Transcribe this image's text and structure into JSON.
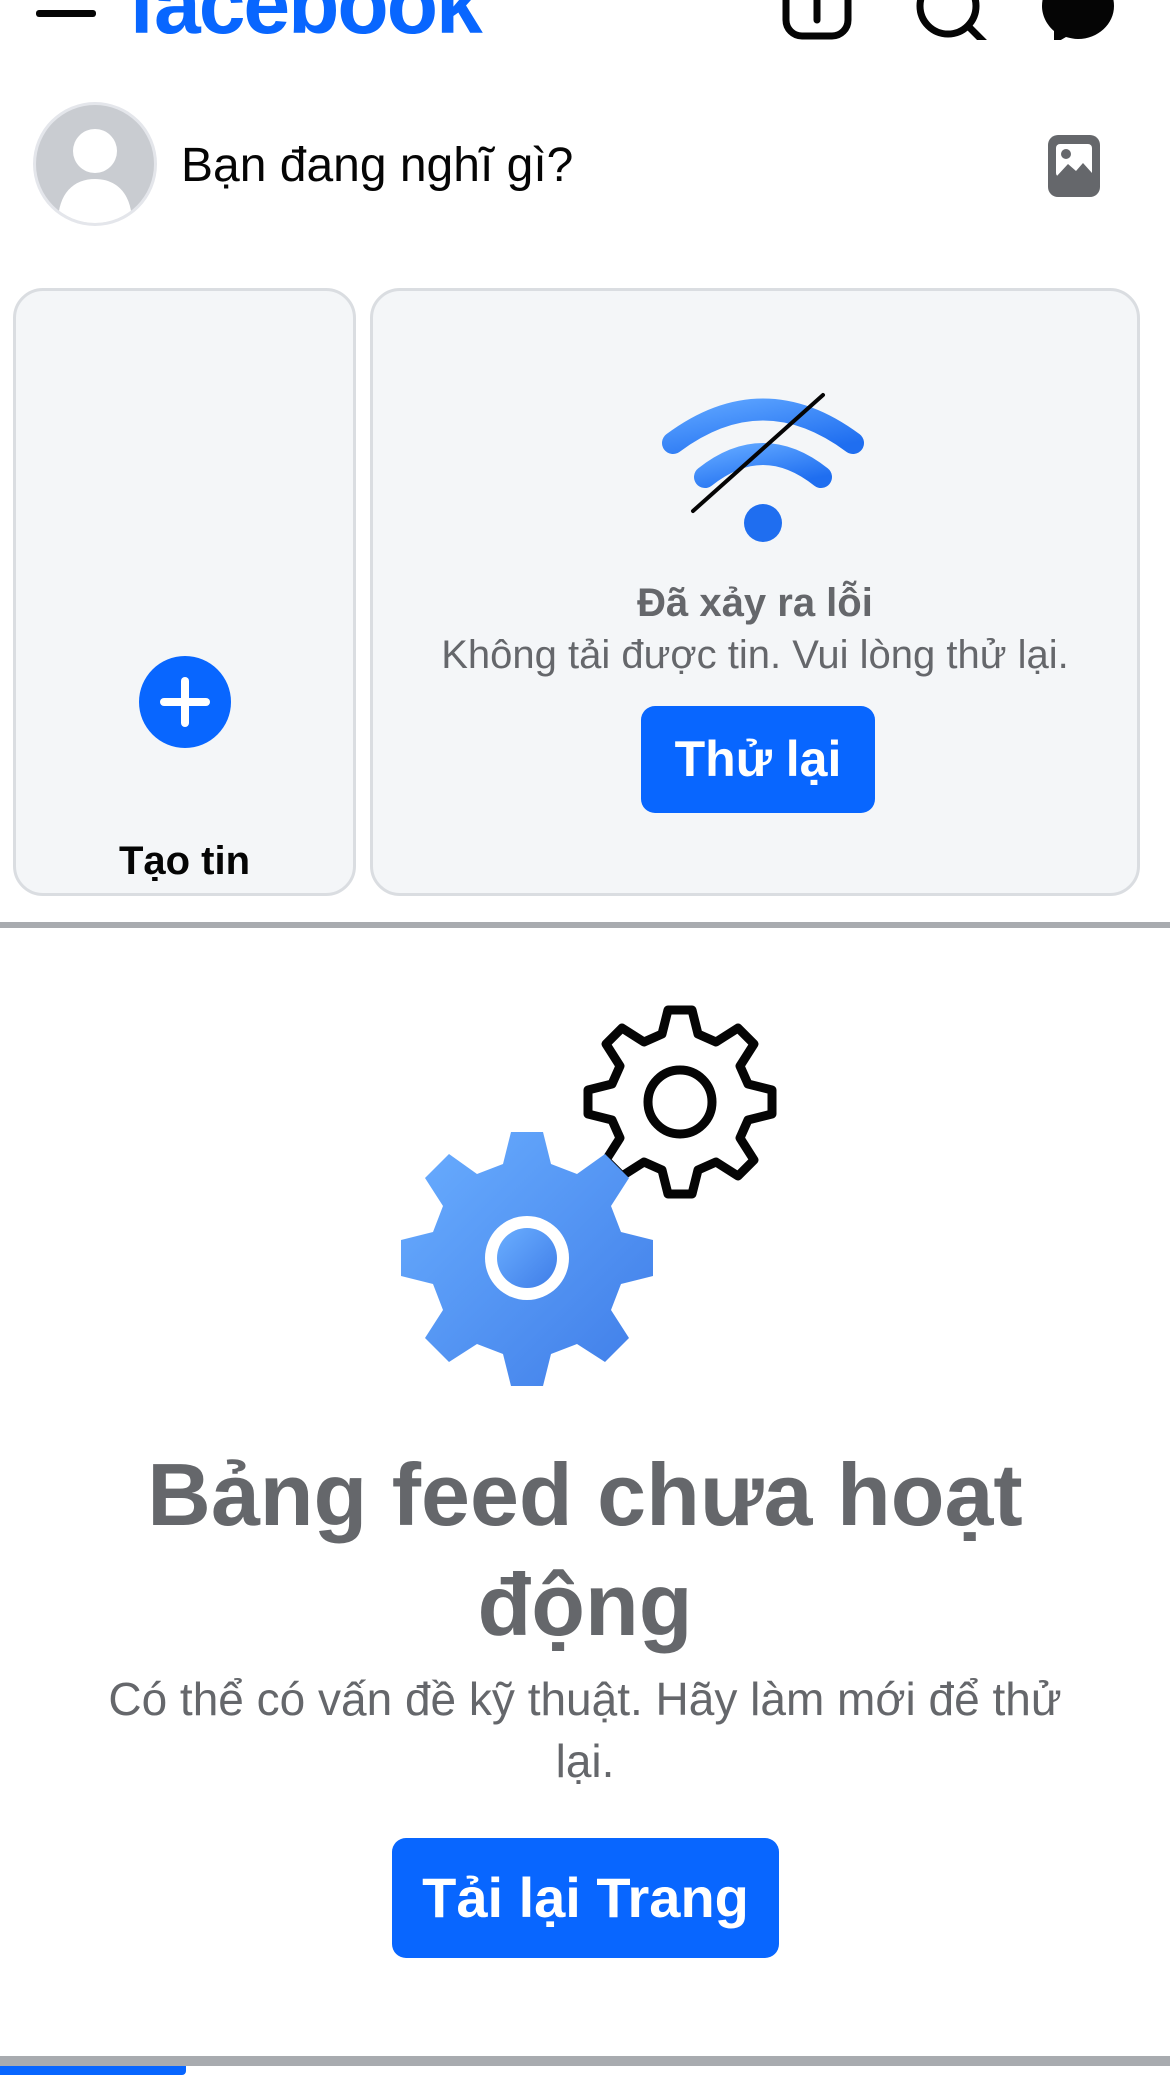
{
  "header": {
    "logo": "facebook",
    "icons": [
      "menu-icon",
      "add-icon",
      "search-icon",
      "messenger-icon"
    ]
  },
  "composer": {
    "prompt": "Bạn đang nghĩ gì?",
    "icons": [
      "avatar",
      "photo-icon"
    ]
  },
  "stories": {
    "create_label": "Tạo tin",
    "error_title": "Đã xảy ra lỗi",
    "error_message": "Không tải được tin. Vui lòng thử lại.",
    "retry_label": "Thử lại",
    "icons": [
      "plus-icon",
      "wifi-off-icon"
    ]
  },
  "feed": {
    "title": "Bảng feed chưa hoạt động",
    "message": "Có thể có vấn đề kỹ thuật. Hãy làm mới để thử lại.",
    "reload_label": "Tải lại Trang",
    "icons": [
      "gears-icon"
    ]
  },
  "colors": {
    "brand": "#0866ff",
    "muted_text": "#65676b",
    "card_bg": "#f4f6f8",
    "divider": "#a8abaf"
  }
}
